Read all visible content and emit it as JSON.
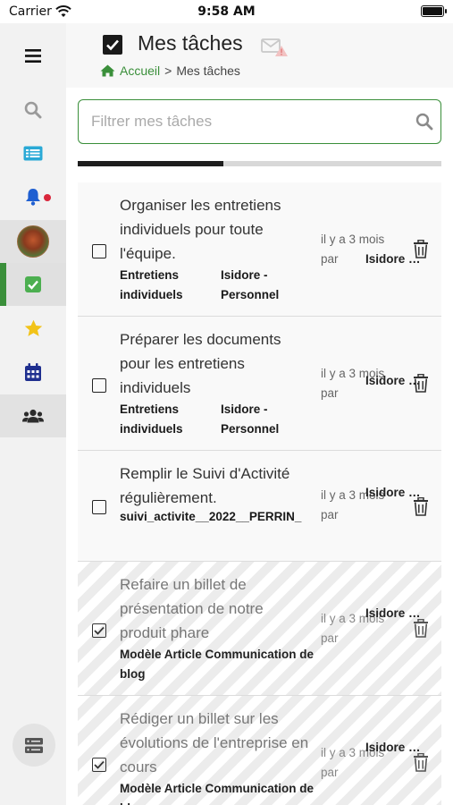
{
  "status_bar": {
    "carrier": "Carrier",
    "time": "9:58 AM"
  },
  "header": {
    "title": "Mes tâches",
    "breadcrumb": {
      "home": "Accueil",
      "separator": ">",
      "current": "Mes tâches"
    }
  },
  "filter": {
    "placeholder": "Filtrer mes tâches",
    "value": ""
  },
  "progress": {
    "fraction": 0.4
  },
  "tasks": [
    {
      "title": "Organiser les entretiens individuels pour toute l'équipe.",
      "tag": "Entretiens individuels",
      "owner_group": "Isidore - Personnel",
      "when": "il y a 3 mois par",
      "by": "Isidore P…",
      "done": false
    },
    {
      "title": "Préparer les documents pour les entretiens individuels",
      "tag": "Entretiens individuels",
      "owner_group": "Isidore - Personnel",
      "when": "il y a 3 mois par",
      "by": "Isidore P…",
      "done": false
    },
    {
      "title": "Remplir le Suivi d'Activité régulièrement.",
      "tag": "suivi_activite__2022__PERRIN_",
      "owner_group": "",
      "when": "il y a 3 mois par",
      "by": "Isidore P…",
      "done": false
    },
    {
      "title": "Refaire un billet de présentation de notre produit phare",
      "tag": "Modèle Article Communication de blog",
      "owner_group": "",
      "when": "il y a 3 mois par",
      "by": "Isidore P…",
      "done": true
    },
    {
      "title": "Rédiger un billet sur les évolutions de l'entreprise en cours",
      "tag": "Modèle Article Communication de blog",
      "owner_group": "",
      "when": "il y a 3 mois par",
      "by": "Isidore P…",
      "done": true
    }
  ],
  "colors": {
    "accent": "#3a8f3a",
    "notification": "#d9263b",
    "nav_blue": "#1f2f8f",
    "info_blue": "#2aa9d6",
    "star": "#f2c318"
  }
}
